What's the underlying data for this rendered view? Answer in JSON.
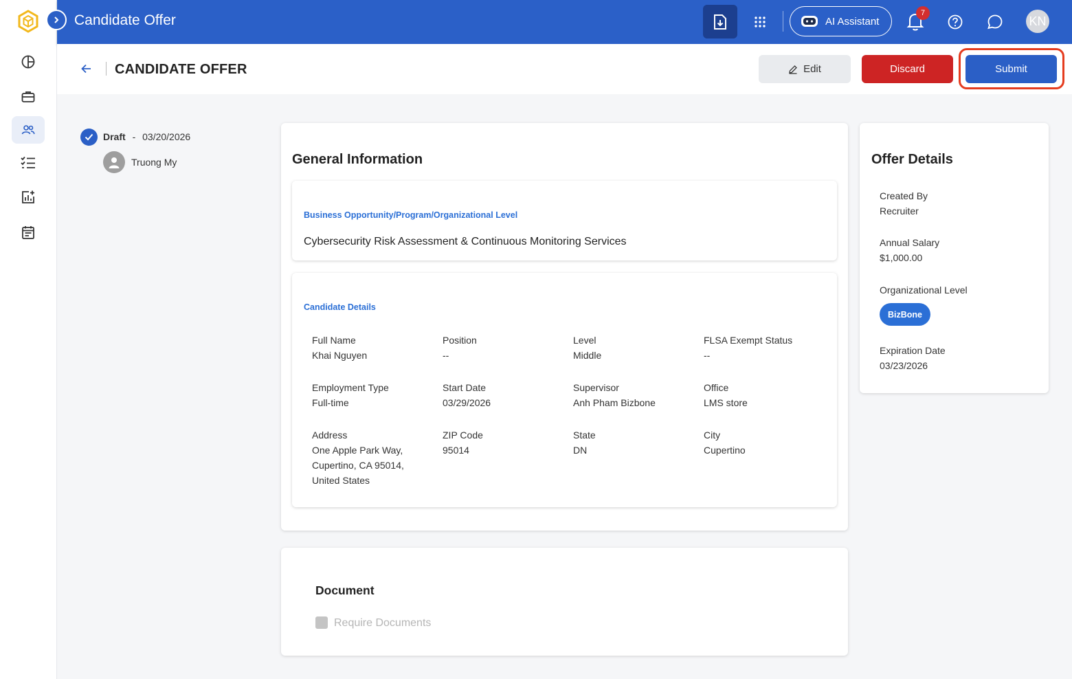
{
  "app": {
    "title": "Candidate Offer",
    "ai_assistant_label": "AI Assistant",
    "notification_count": "7",
    "avatar_initials": "KN",
    "brand_color": "#2b60c8"
  },
  "sidebar": {
    "items": [
      {
        "icon": "dashboard-icon"
      },
      {
        "icon": "briefcase-icon"
      },
      {
        "icon": "people-icon",
        "active": true
      },
      {
        "icon": "checklist-icon"
      },
      {
        "icon": "analytics-add-icon"
      },
      {
        "icon": "calendar-icon"
      }
    ]
  },
  "header": {
    "page_title": "CANDIDATE OFFER",
    "edit_label": "Edit",
    "discard_label": "Discard",
    "submit_label": "Submit"
  },
  "status": {
    "state": "Draft",
    "separator": "-",
    "date": "03/20/2026",
    "person": "Truong My"
  },
  "general": {
    "title": "General Information",
    "opportunity": {
      "title": "Business Opportunity/Program/Organizational Level",
      "value": "Cybersecurity Risk Assessment & Continuous Monitoring Services"
    },
    "candidate": {
      "title": "Candidate Details",
      "full_name": {
        "label": "Full Name",
        "value": "Khai Nguyen"
      },
      "position": {
        "label": "Position",
        "value": "--"
      },
      "level": {
        "label": "Level",
        "value": "Middle"
      },
      "flsa": {
        "label": "FLSA Exempt Status",
        "value": "--"
      },
      "employment_type": {
        "label": "Employment Type",
        "value": "Full-time"
      },
      "start_date": {
        "label": "Start Date",
        "value": "03/29/2026"
      },
      "supervisor": {
        "label": "Supervisor",
        "value": "Anh Pham Bizbone"
      },
      "office": {
        "label": "Office",
        "value": "LMS store"
      },
      "address": {
        "label": "Address",
        "line1": "One Apple Park Way,",
        "line2": "Cupertino, CA 95014,",
        "line3": "United States"
      },
      "zip": {
        "label": "ZIP Code",
        "value": "95014"
      },
      "state": {
        "label": "State",
        "value": "DN"
      },
      "city": {
        "label": "City",
        "value": "Cupertino"
      }
    }
  },
  "document": {
    "title": "Document",
    "require_label": "Require Documents",
    "require_checked": false
  },
  "offer": {
    "title": "Offer Details",
    "created_by": {
      "label": "Created By",
      "value": "Recruiter"
    },
    "salary": {
      "label": "Annual Salary",
      "value": "$1,000.00"
    },
    "org_level": {
      "label": "Organizational Level",
      "value": "BizBone"
    },
    "expiration": {
      "label": "Expiration Date",
      "value": "03/23/2026"
    }
  }
}
